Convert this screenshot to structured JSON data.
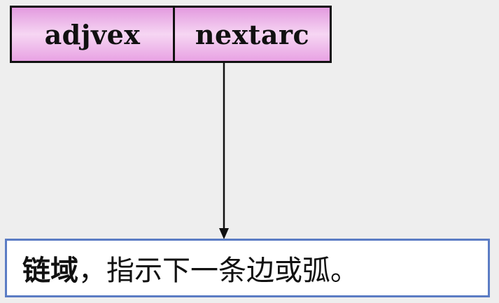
{
  "node": {
    "field1": "adjvex",
    "field2": "nextarc"
  },
  "caption": {
    "strong": "链域",
    "rest": "，指示下一条边或弧。"
  },
  "colors": {
    "node_fill": "#e39adf",
    "caption_border": "#5b7cc4"
  }
}
